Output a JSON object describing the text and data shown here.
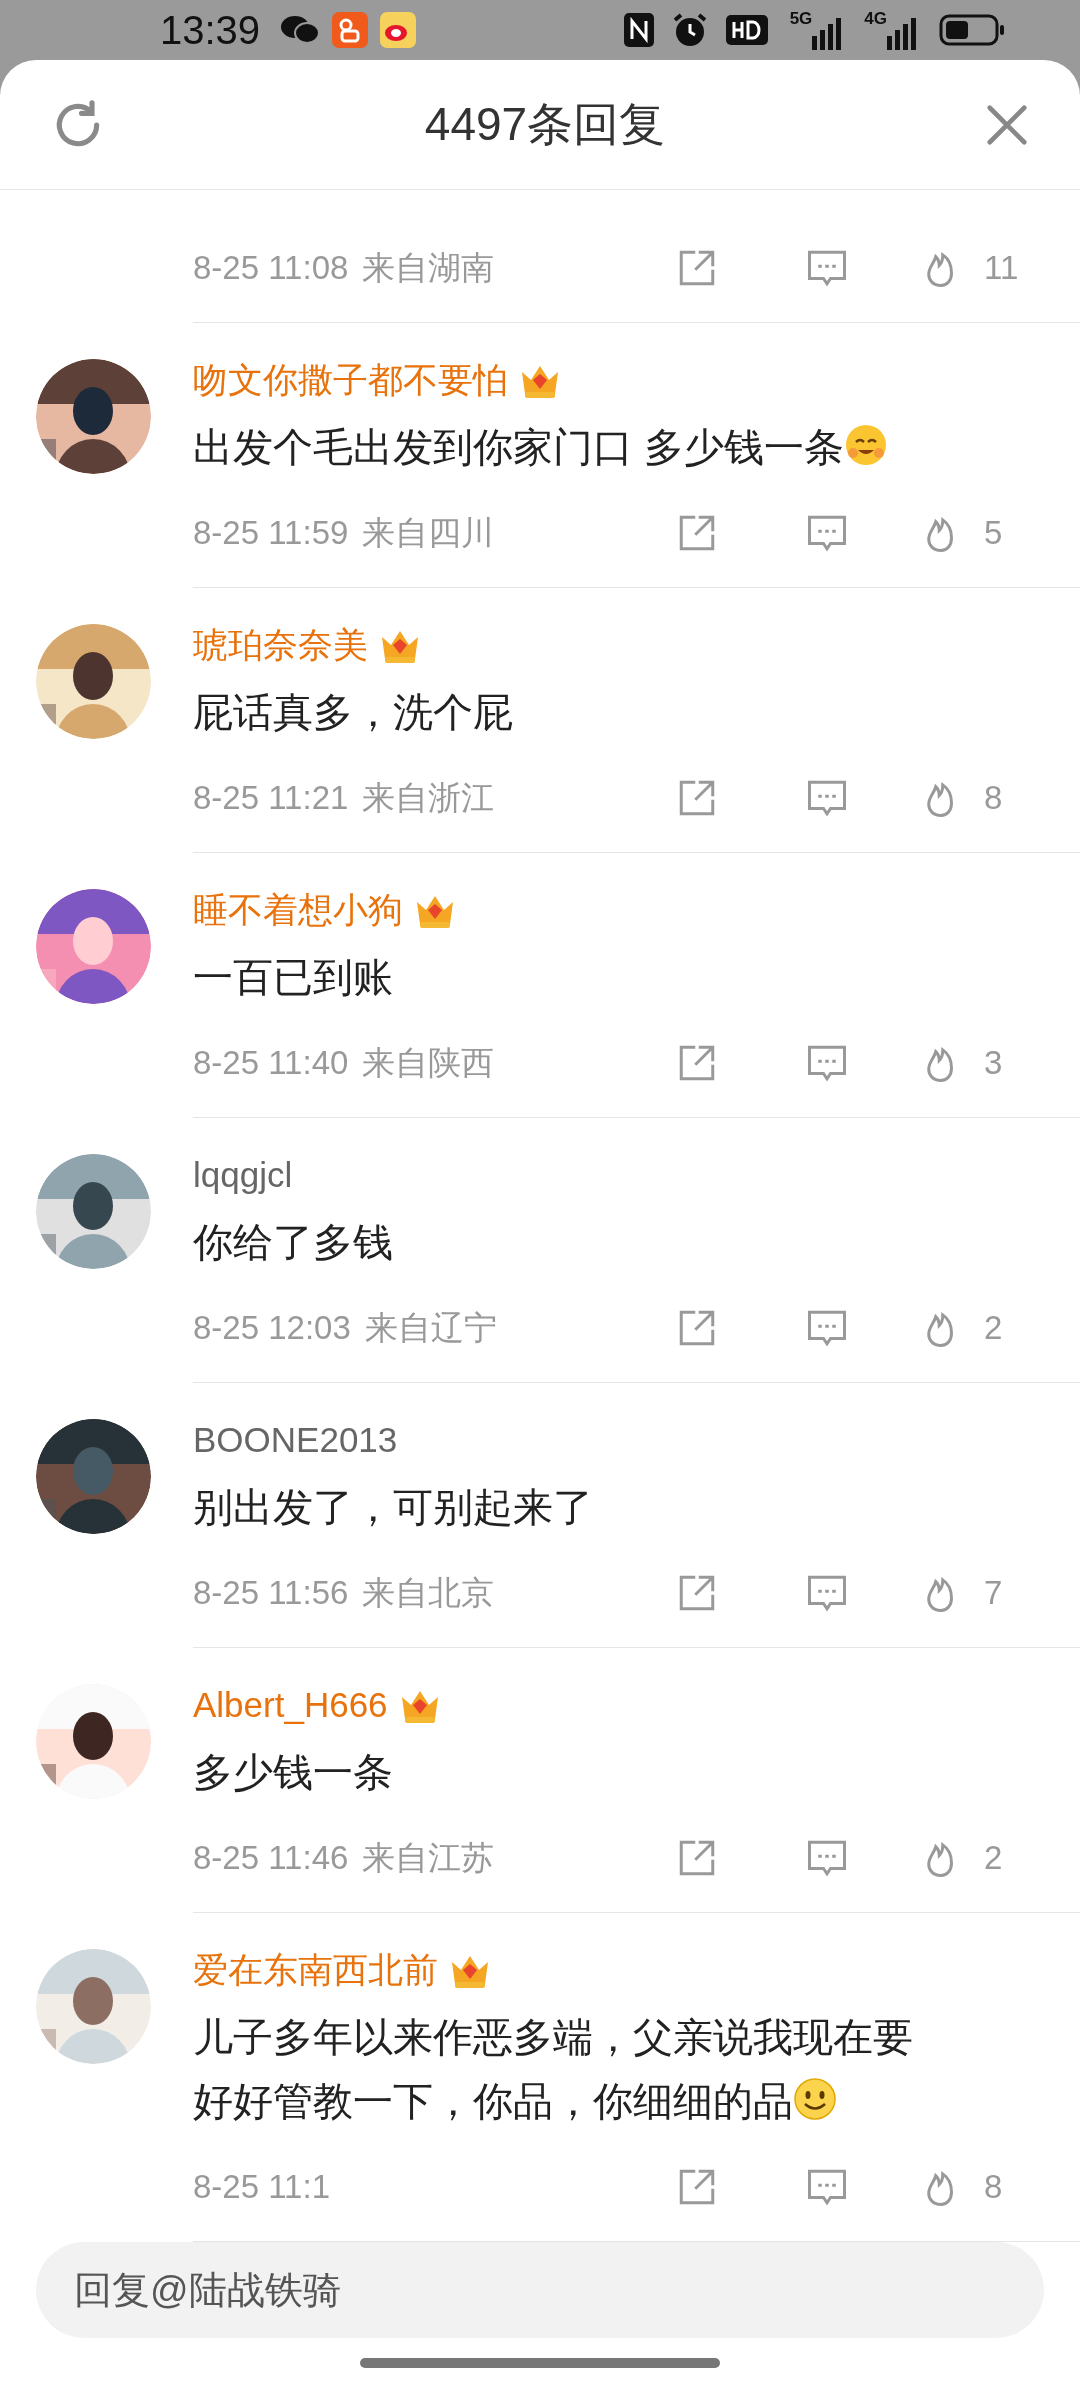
{
  "status_bar": {
    "time": "13:39",
    "networks": [
      "5G",
      "4G"
    ]
  },
  "header": {
    "title": "4497条回复"
  },
  "comments": [
    {
      "partial": true,
      "date": "8-25 11:08",
      "location": "来自湖南",
      "likes": "11"
    },
    {
      "partial": false,
      "name": "吻文你撒子都不要怕",
      "vip": true,
      "text": "出发个毛出发到你家门口 多少钱一条",
      "trailing_emoji": {
        "kind": "blush"
      },
      "date": "8-25 11:59",
      "location": "来自四川",
      "likes": "5"
    },
    {
      "partial": false,
      "name": "琥珀奈奈美",
      "vip": true,
      "text": "屁话真多，洗个屁",
      "date": "8-25 11:21",
      "location": "来自浙江",
      "likes": "8"
    },
    {
      "partial": false,
      "name": "睡不着想小狗",
      "vip": true,
      "text": "一百已到账",
      "date": "8-25 11:40",
      "location": "来自陕西",
      "likes": "3"
    },
    {
      "partial": false,
      "name": "lqqgjcl",
      "vip": false,
      "text": "你给了多钱",
      "date": "8-25 12:03",
      "location": "来自辽宁",
      "likes": "2"
    },
    {
      "partial": false,
      "name": "BOONE2013",
      "vip": false,
      "text": "别出发了，可别起来了",
      "date": "8-25 11:56",
      "location": "来自北京",
      "likes": "7"
    },
    {
      "partial": false,
      "name": "Albert_H666",
      "vip": true,
      "text": "多少钱一条",
      "date": "8-25 11:46",
      "location": "来自江苏",
      "likes": "2"
    },
    {
      "partial": false,
      "name": "爱在东南西北前",
      "vip": true,
      "text": "儿子多年以来作恶多端，父亲说我现在要好好管教一下，你品，你细细的品",
      "trailing_emoji": {
        "kind": "smile"
      },
      "date": "8-25 11:1",
      "likes": "8"
    }
  ],
  "reply_box": {
    "placeholder": "回复@陆战铁骑"
  }
}
